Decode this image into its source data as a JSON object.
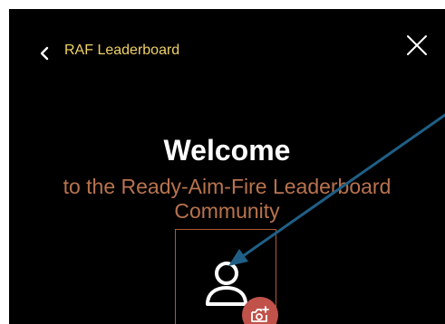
{
  "header": {
    "title": "RAF Leaderboard",
    "back_icon": "chevron-left-icon",
    "close_icon": "close-icon"
  },
  "welcome": {
    "title": "Welcome",
    "subtitle": "to the Ready-Aim-Fire Leaderboard Community"
  },
  "avatar": {
    "icon": "user-icon",
    "upload_icon": "camera-plus-icon"
  },
  "colors": {
    "background": "#000000",
    "header_title": "#f0d268",
    "title": "#ffffff",
    "subtitle": "#b8734e",
    "avatar_border": "#b05a2e",
    "camera_badge": "#c0524a",
    "annotation_arrow": "#1f5f86"
  }
}
